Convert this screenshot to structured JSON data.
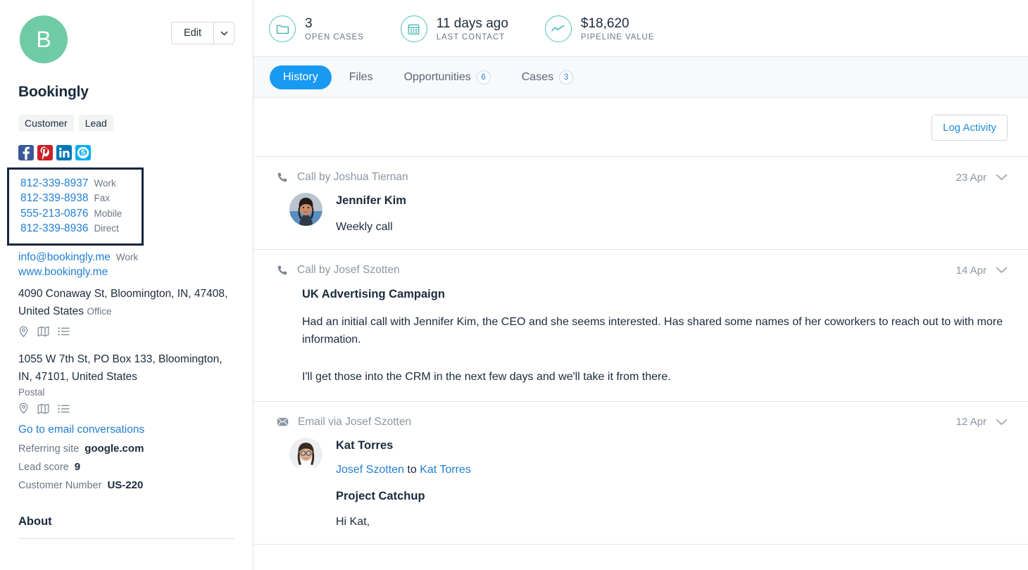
{
  "sidebar": {
    "avatar_letter": "B",
    "avatar_color": "#6ecba5",
    "edit_label": "Edit",
    "org_name": "Bookingly",
    "tags": [
      "Customer",
      "Lead"
    ],
    "socials": [
      {
        "name": "facebook-icon",
        "glyph": "f",
        "color": "#3b5998"
      },
      {
        "name": "pinterest-icon",
        "glyph": "P",
        "color": "#cb2027"
      },
      {
        "name": "linkedin-icon",
        "glyph": "in",
        "color": "#0077b5"
      },
      {
        "name": "skype-icon",
        "glyph": "S",
        "color": "#00aff0"
      }
    ],
    "phones": [
      {
        "number": "812-339-8937",
        "label": "Work"
      },
      {
        "number": "812-339-8938",
        "label": "Fax"
      },
      {
        "number": "555-213-0876",
        "label": "Mobile"
      },
      {
        "number": "812-339-8936",
        "label": "Direct"
      }
    ],
    "email": {
      "value": "info@bookingly.me",
      "label": "Work"
    },
    "website": "www.bookingly.me",
    "addresses": [
      {
        "text": "4090 Conaway St, Bloomington, IN, 47408, United States",
        "label": "Office"
      },
      {
        "text": "1055 W 7th St, PO Box 133, Bloomington, IN, 47101, United States",
        "label": "Postal"
      }
    ],
    "go_to_email": "Go to email conversations",
    "fields": [
      {
        "key": "Referring site",
        "value": "google.com"
      },
      {
        "key": "Lead score",
        "value": "9"
      },
      {
        "key": "Customer Number",
        "value": "US-220"
      }
    ],
    "about_heading": "About"
  },
  "stats": [
    {
      "icon": "folder-icon",
      "value": "3",
      "label": "OPEN CASES"
    },
    {
      "icon": "calendar-icon",
      "value": "11 days ago",
      "label": "LAST CONTACT"
    },
    {
      "icon": "trend-line-icon",
      "value": "$18,620",
      "label": "PIPELINE VALUE"
    }
  ],
  "tabs": [
    {
      "label": "History",
      "badge": "",
      "active": true
    },
    {
      "label": "Files",
      "badge": "",
      "active": false
    },
    {
      "label": "Opportunities",
      "badge": "6",
      "active": false
    },
    {
      "label": "Cases",
      "badge": "3",
      "active": false
    }
  ],
  "toolbar": {
    "log_activity_label": "Log Activity"
  },
  "activities": [
    {
      "type_text": "Call by Joshua Tiernan",
      "icon": "phone-icon",
      "date": "23 Apr",
      "person": "Jennifer Kim",
      "note": "Weekly call"
    },
    {
      "type_text": "Call by Josef Szotten",
      "icon": "phone-icon",
      "date": "14 Apr",
      "title": "UK Advertising Campaign",
      "paragraph1": "Had an initial call with Jennifer Kim, the CEO and she seems interested. Has shared some names of her coworkers to reach out to with more information.",
      "paragraph2": "I'll get those into the CRM in the next few days and we'll take it from there."
    },
    {
      "type_text": "Email via Josef Szotten",
      "icon": "envelope-icon",
      "date": "12 Apr",
      "person": "Kat Torres",
      "from": "Josef Szotten",
      "to_word": "to",
      "to": "Kat Torres",
      "subject": "Project Catchup",
      "snippet": "Hi Kat,"
    }
  ],
  "colors": {
    "accent_blue": "#1899f2",
    "link_blue": "#1f7fd6",
    "teal": "#4ec4bc",
    "highlight_border": "#16243f"
  }
}
